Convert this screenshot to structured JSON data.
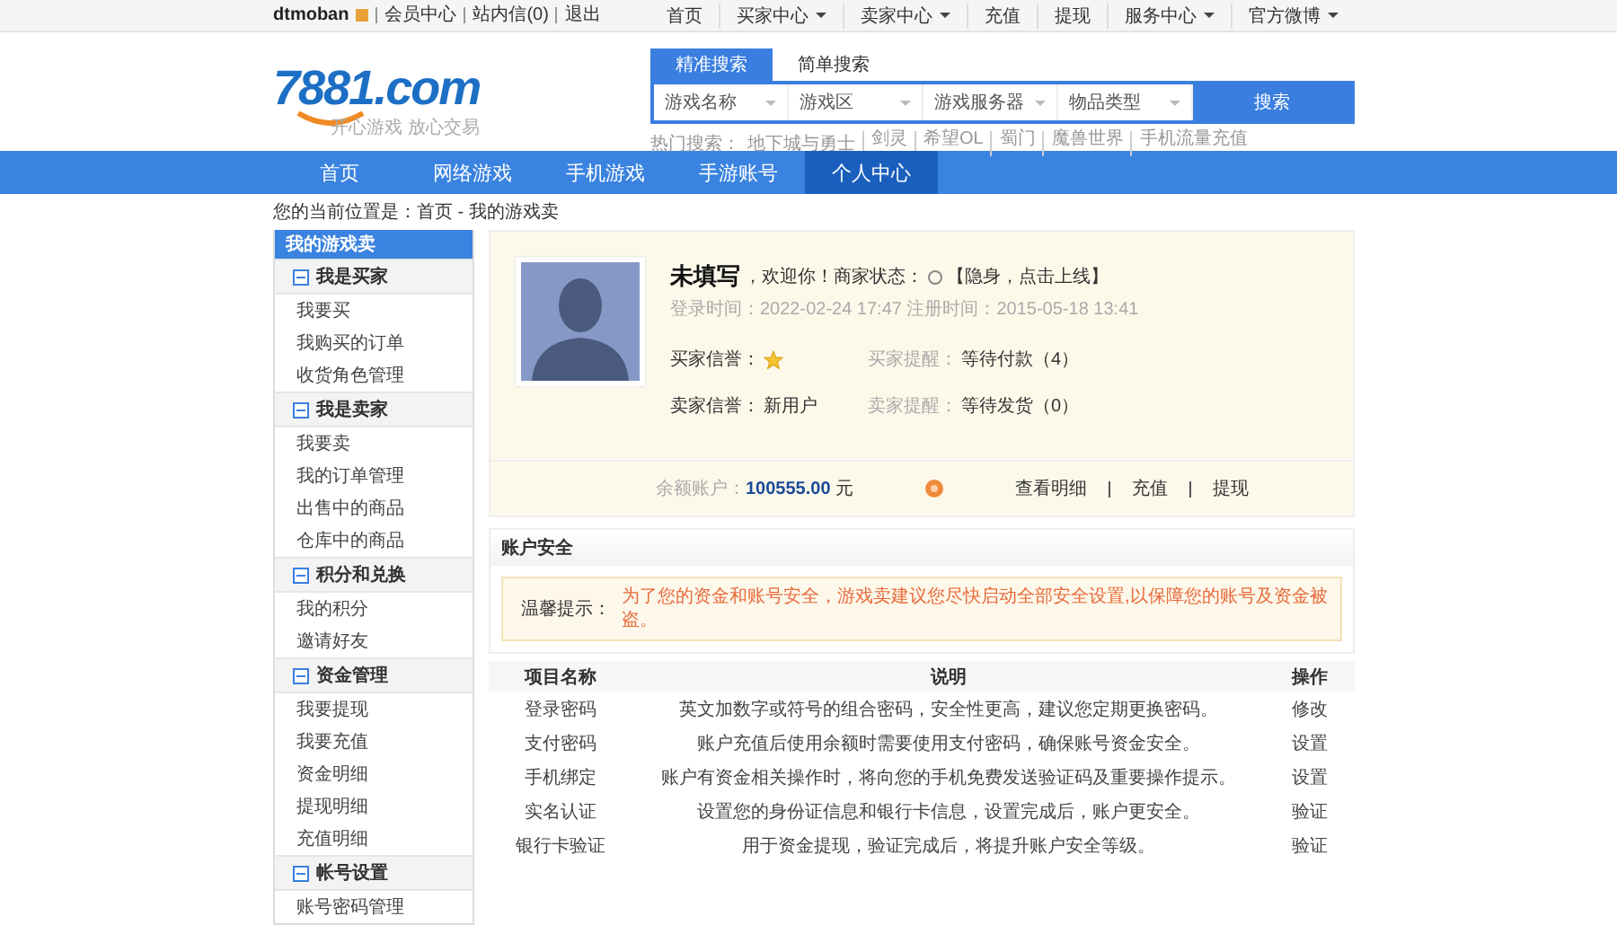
{
  "top_bar": {
    "username": "dtmoban",
    "links": [
      "会员中心",
      "站内信(0)",
      "退出"
    ],
    "right_menu": [
      {
        "label": "首页",
        "dropdown": false
      },
      {
        "label": "买家中心",
        "dropdown": true
      },
      {
        "label": "卖家中心",
        "dropdown": true
      },
      {
        "label": "充值",
        "dropdown": false
      },
      {
        "label": "提现",
        "dropdown": false
      },
      {
        "label": "服务中心",
        "dropdown": true
      },
      {
        "label": "官方微博",
        "dropdown": true
      }
    ]
  },
  "logo": {
    "text": "7881.com",
    "slogan": "开心游戏 放心交易"
  },
  "search": {
    "tabs": [
      {
        "label": "精准搜索",
        "selected": true
      },
      {
        "label": "简单搜索",
        "selected": false
      }
    ],
    "selects": [
      "游戏名称",
      "游戏区",
      "游戏服务器",
      "物品类型"
    ],
    "button": "搜索",
    "hot_label": "热门搜索：",
    "hot_links": [
      "地下城与勇士",
      "剑灵",
      "希望OL",
      "蜀门",
      "魔兽世界",
      "手机流量充值"
    ]
  },
  "nav": [
    {
      "label": "首页",
      "selected": false
    },
    {
      "label": "网络游戏",
      "selected": false
    },
    {
      "label": "手机游戏",
      "selected": false
    },
    {
      "label": "手游账号",
      "selected": false
    },
    {
      "label": "个人中心",
      "selected": true
    }
  ],
  "breadcrumb": "您的当前位置是：首页 - 我的游戏卖",
  "sidebar": {
    "title": "我的游戏卖",
    "groups": [
      {
        "label": "我是买家",
        "expanded": true,
        "items": [
          "我要买",
          "我购买的订单",
          "收货角色管理"
        ]
      },
      {
        "label": "我是卖家",
        "expanded": true,
        "items": [
          "我要卖",
          "我的订单管理",
          "出售中的商品",
          "仓库中的商品"
        ]
      },
      {
        "label": "积分和兑换",
        "expanded": true,
        "items": [
          "我的积分",
          "邀请好友"
        ]
      },
      {
        "label": "资金管理",
        "expanded": true,
        "items": [
          "我要提现",
          "我要充值",
          "资金明细",
          "提现明细",
          "充值明细"
        ]
      },
      {
        "label": "帐号设置",
        "expanded": true,
        "items": [
          "账号密码管理"
        ]
      }
    ]
  },
  "profile": {
    "name": "未填写",
    "welcome": "，欢迎你！商家状态：",
    "status": "【隐身，点击上线】",
    "times": "登录时间：2022-02-24 17:47 注册时间：2015-05-18 13:41",
    "buyer_credit_label": "买家信誉：",
    "buyer_notice_label": "买家提醒：",
    "buyer_notice": "等待付款（4）",
    "seller_credit_label": "卖家信誉：",
    "seller_credit": "新用户",
    "seller_notice_label": "卖家提醒：",
    "seller_notice": "等待发货（0）",
    "balance_label": "余额账户：",
    "balance": "100555.00",
    "currency": "元",
    "actions": [
      "查看明细",
      "充值",
      "提现"
    ]
  },
  "security": {
    "title": "账户安全",
    "tip_label": "温馨提示：",
    "tip": "为了您的资金和账号安全，游戏卖建议您尽快启动全部安全设置,以保障您的账号及资金被盗。",
    "columns": [
      "项目名称",
      "说明",
      "操作"
    ],
    "rows": [
      {
        "name": "登录密码",
        "description": "英文加数字或符号的组合密码，安全性更高，建议您定期更换密码。",
        "action": "修改"
      },
      {
        "name": "支付密码",
        "description": "账户充值后使用余额时需要使用支付密码，确保账号资金安全。",
        "action": "设置"
      },
      {
        "name": "手机绑定",
        "description": "账户有资金相关操作时，将向您的手机免费发送验证码及重要操作提示。",
        "action": "设置"
      },
      {
        "name": "实名认证",
        "description": "设置您的身份证信息和银行卡信息，设置完成后，账户更安全。",
        "action": "验证"
      },
      {
        "name": "银行卡验证",
        "description": "用于资金提现，验证完成后，将提升账户安全等级。",
        "action": "验证"
      }
    ]
  }
}
